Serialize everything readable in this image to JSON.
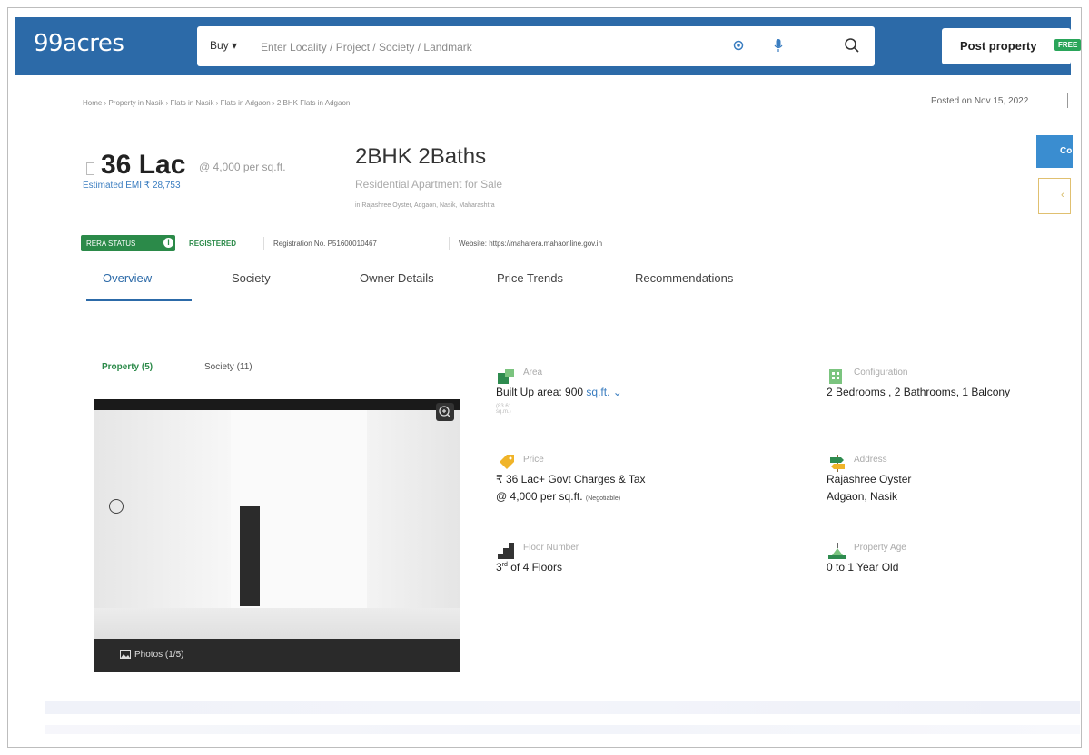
{
  "header": {
    "logo": "99acres",
    "buy_label": "Buy",
    "search_placeholder": "Enter Locality / Project / Society / Landmark",
    "post_property_label": "Post property",
    "free_badge": "FREE"
  },
  "breadcrumb": "Home › Property in Nasik › Flats in Nasik › Flats in Adgaon › 2 BHK Flats in Adgaon",
  "posted_on": "Posted on Nov 15, 2022",
  "listing": {
    "price": "36 Lac",
    "price_per_sqft": "@ 4,000 per sq.ft.",
    "emi": "Estimated EMI ₹ 28,753",
    "title": "2BHK 2Baths",
    "subtitle": "Residential Apartment for Sale",
    "locality": "in Rajashree Oyster, Adgaon, Nasik, Maharashtra",
    "contact_btn": "Co"
  },
  "rera": {
    "badge": "RERA STATUS",
    "info_icon": "info-icon",
    "status": "REGISTERED",
    "registration": "Registration No. P51600010467",
    "website": "Website: https://maharera.mahaonline.gov.in"
  },
  "tabs": [
    {
      "label": "Overview",
      "active": true
    },
    {
      "label": "Society",
      "active": false
    },
    {
      "label": "Owner Details",
      "active": false
    },
    {
      "label": "Price Trends",
      "active": false
    },
    {
      "label": "Recommendations",
      "active": false
    }
  ],
  "media_tabs": {
    "property": "Property (5)",
    "society": "Society (11)"
  },
  "photo": {
    "label": "Photos (1/5)"
  },
  "specs": {
    "area": {
      "label": "Area",
      "value": "Built Up area: 900",
      "unit": "sq.ft.",
      "sub": "(83.61 sq.m.)"
    },
    "configuration": {
      "label": "Configuration",
      "value": "2 Bedrooms , 2 Bathrooms, 1 Balcony"
    },
    "price": {
      "label": "Price",
      "value": "₹ 36 Lac+ Govt Charges & Tax",
      "value2": "@ 4,000 per sq.ft.",
      "note": "(Negotiable)"
    },
    "address": {
      "label": "Address",
      "value": "Rajashree Oyster",
      "value2": "Adgaon, Nasik"
    },
    "floor": {
      "label": "Floor Number",
      "value": "3",
      "sup": "rd",
      "rest": " of 4 Floors"
    },
    "age": {
      "label": "Property Age",
      "value": "0 to 1 Year Old"
    }
  },
  "colors": {
    "brand": "#2c6aa8",
    "green": "#2b8a49",
    "link": "#3a7dc0"
  }
}
